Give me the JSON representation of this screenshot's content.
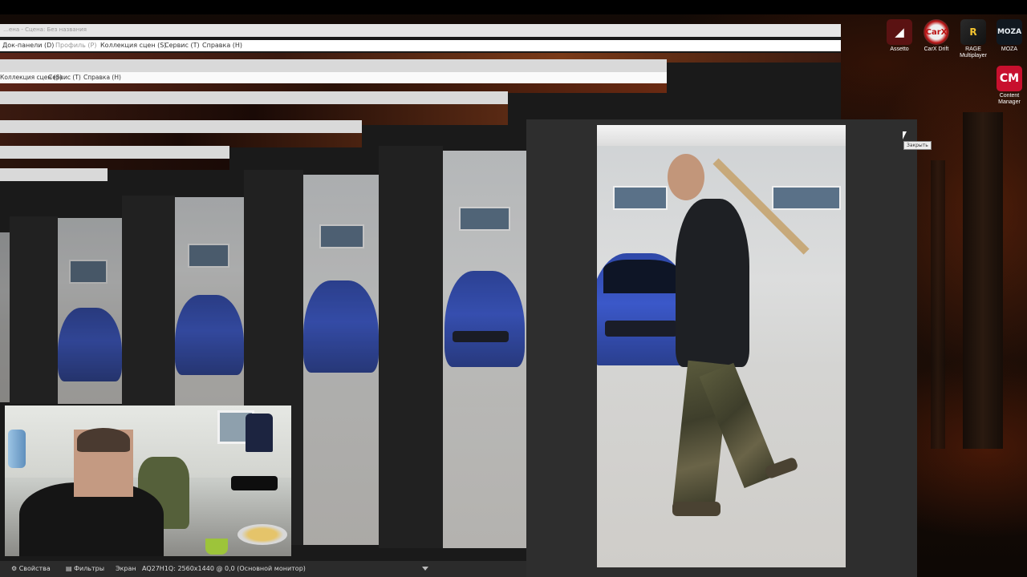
{
  "main_window": {
    "title": "…ена - Сцена: Без названия",
    "menu": [
      "Док-панели (D)",
      "Профиль (P)",
      "Коллекция сцен (S)",
      "Сервис (T)",
      "Справка (H)"
    ]
  },
  "ghost_menu_2": [
    "Коллекция сцен (S)",
    "Сервис (T)",
    "Справка (H)"
  ],
  "desktop_icons": [
    {
      "label": "Assetto",
      "icon": "assetto-icon",
      "glyph": "◢"
    },
    {
      "label": "CarX Drift",
      "icon": "carx-drift-icon",
      "glyph": "CarX"
    },
    {
      "label": "RAGE Multiplayer",
      "icon": "rage-mp-icon",
      "glyph": "R"
    },
    {
      "label": "MOZA",
      "icon": "moza-icon",
      "glyph": "MOZA"
    },
    {
      "label": "Content Manager",
      "icon": "content-manager-icon",
      "glyph": "CM"
    }
  ],
  "tooltip": "Закрыть",
  "status_bar": {
    "properties": "Свойства",
    "filters": "Фильтры",
    "screen_label": "Экран",
    "screen_value": "AQ27H1Q: 2560x1440 @ 0,0 (Основной монитор)"
  }
}
